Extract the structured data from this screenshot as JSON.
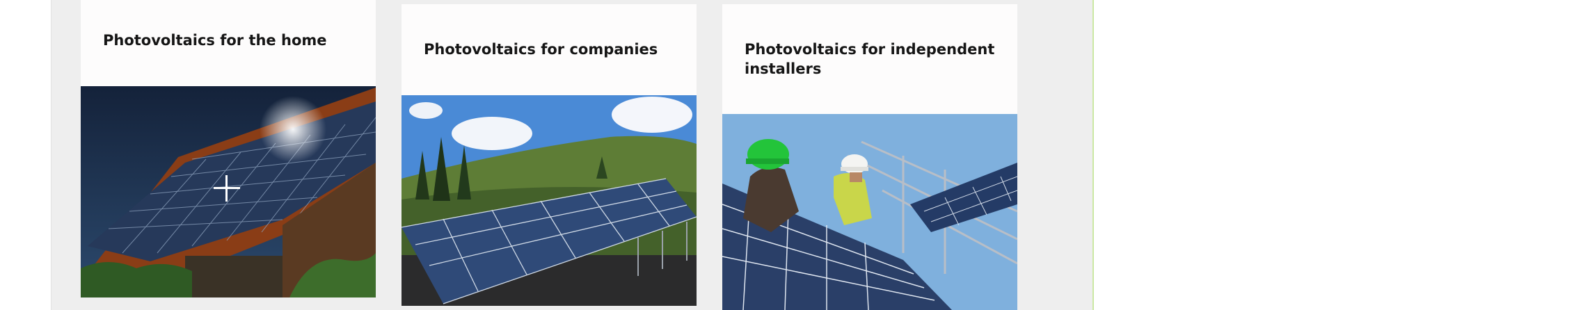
{
  "cards": [
    {
      "title": "Photovoltaics for the home",
      "image": "house-roof-solar-panels"
    },
    {
      "title": "Photovoltaics for companies",
      "image": "solar-field-on-hillside"
    },
    {
      "title": "Photovoltaics for independent installers",
      "image": "installers-with-helmets-on-solar-array"
    }
  ],
  "colors": {
    "page_background": "#eeeeee",
    "card_background": "#fdfcfc",
    "accent_line": "#cbe8a2",
    "title_text": "#151515"
  },
  "icons": {
    "cursor": "crosshair-cursor-icon"
  }
}
